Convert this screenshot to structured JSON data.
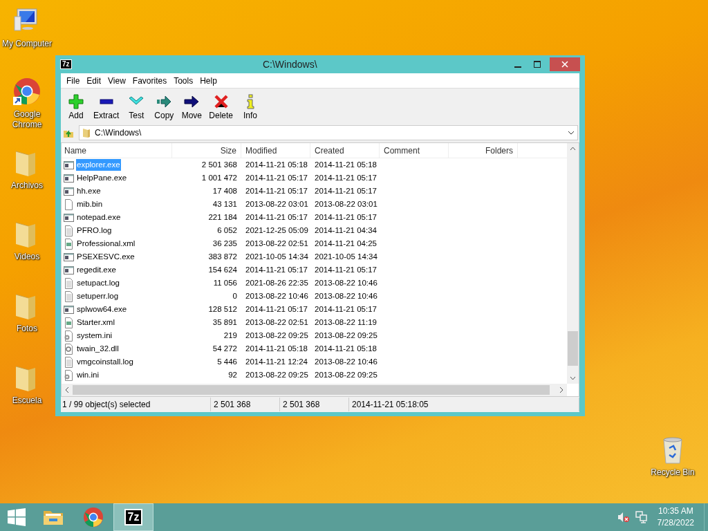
{
  "desktop_icons": [
    {
      "label": "My Computer",
      "kind": "computer"
    },
    {
      "label": "Google Chrome",
      "kind": "chrome"
    },
    {
      "label": "Archivos",
      "kind": "folder"
    },
    {
      "label": "Videos",
      "kind": "folder"
    },
    {
      "label": "Fotos",
      "kind": "folder"
    },
    {
      "label": "Escuela",
      "kind": "folder"
    },
    {
      "label": "Recycle Bin",
      "kind": "bin"
    }
  ],
  "window": {
    "app_icon": "7z",
    "title": "C:\\Windows\\"
  },
  "menu": [
    "File",
    "Edit",
    "View",
    "Favorites",
    "Tools",
    "Help"
  ],
  "toolbar": [
    {
      "label": "Add",
      "kind": "add"
    },
    {
      "label": "Extract",
      "kind": "extract"
    },
    {
      "label": "Test",
      "kind": "test"
    },
    {
      "label": "Copy",
      "kind": "copy"
    },
    {
      "label": "Move",
      "kind": "move"
    },
    {
      "label": "Delete",
      "kind": "delete"
    },
    {
      "label": "Info",
      "kind": "info"
    }
  ],
  "address": {
    "value": "C:\\Windows\\"
  },
  "table": {
    "columns": [
      "Name",
      "Size",
      "Modified",
      "Created",
      "Comment",
      "Folders"
    ],
    "rows": [
      {
        "name": "explorer.exe",
        "size": "2 501 368",
        "modified": "2014-11-21 05:18",
        "created": "2014-11-21 05:18",
        "kind": "exe",
        "selected": true
      },
      {
        "name": "HelpPane.exe",
        "size": "1 001 472",
        "modified": "2014-11-21 05:17",
        "created": "2014-11-21 05:17",
        "kind": "exe",
        "selected": false
      },
      {
        "name": "hh.exe",
        "size": "17 408",
        "modified": "2014-11-21 05:17",
        "created": "2014-11-21 05:17",
        "kind": "exe",
        "selected": false
      },
      {
        "name": "mib.bin",
        "size": "43 131",
        "modified": "2013-08-22 03:01",
        "created": "2013-08-22 03:01",
        "kind": "blank",
        "selected": false
      },
      {
        "name": "notepad.exe",
        "size": "221 184",
        "modified": "2014-11-21 05:17",
        "created": "2014-11-21 05:17",
        "kind": "exe",
        "selected": false
      },
      {
        "name": "PFRO.log",
        "size": "6 052",
        "modified": "2021-12-25 05:09",
        "created": "2014-11-21 04:34",
        "kind": "text",
        "selected": false
      },
      {
        "name": "Professional.xml",
        "size": "36 235",
        "modified": "2013-08-22 02:51",
        "created": "2014-11-21 04:25",
        "kind": "xml",
        "selected": false
      },
      {
        "name": "PSEXESVC.exe",
        "size": "383 872",
        "modified": "2021-10-05 14:34",
        "created": "2021-10-05 14:34",
        "kind": "exe",
        "selected": false
      },
      {
        "name": "regedit.exe",
        "size": "154 624",
        "modified": "2014-11-21 05:17",
        "created": "2014-11-21 05:17",
        "kind": "exe",
        "selected": false
      },
      {
        "name": "setupact.log",
        "size": "11 056",
        "modified": "2021-08-26 22:35",
        "created": "2013-08-22 10:46",
        "kind": "text",
        "selected": false
      },
      {
        "name": "setuperr.log",
        "size": "0",
        "modified": "2013-08-22 10:46",
        "created": "2013-08-22 10:46",
        "kind": "text",
        "selected": false
      },
      {
        "name": "splwow64.exe",
        "size": "128 512",
        "modified": "2014-11-21 05:17",
        "created": "2014-11-21 05:17",
        "kind": "exe",
        "selected": false
      },
      {
        "name": "Starter.xml",
        "size": "35 891",
        "modified": "2013-08-22 02:51",
        "created": "2013-08-22 11:19",
        "kind": "xml",
        "selected": false
      },
      {
        "name": "system.ini",
        "size": "219",
        "modified": "2013-08-22 09:25",
        "created": "2013-08-22 09:25",
        "kind": "ini",
        "selected": false
      },
      {
        "name": "twain_32.dll",
        "size": "54 272",
        "modified": "2014-11-21 05:18",
        "created": "2014-11-21 05:18",
        "kind": "dll",
        "selected": false
      },
      {
        "name": "vmgcoinstall.log",
        "size": "5 446",
        "modified": "2014-11-21 12:24",
        "created": "2013-08-22 10:46",
        "kind": "text",
        "selected": false
      },
      {
        "name": "win.ini",
        "size": "92",
        "modified": "2013-08-22 09:25",
        "created": "2013-08-22 09:25",
        "kind": "ini",
        "selected": false
      }
    ]
  },
  "status_bar": [
    "1 / 99 object(s) selected",
    "2 501 368",
    "2 501 368",
    "2014-11-21 05:18:05"
  ],
  "taskbar": {
    "apps": [
      {
        "kind": "explorer",
        "selected": false
      },
      {
        "kind": "chrome",
        "selected": false
      },
      {
        "kind": "archiver",
        "label": "7z",
        "selected": true
      }
    ],
    "clock": {
      "time": "10:35 AM",
      "date": "7/28/2022"
    }
  }
}
